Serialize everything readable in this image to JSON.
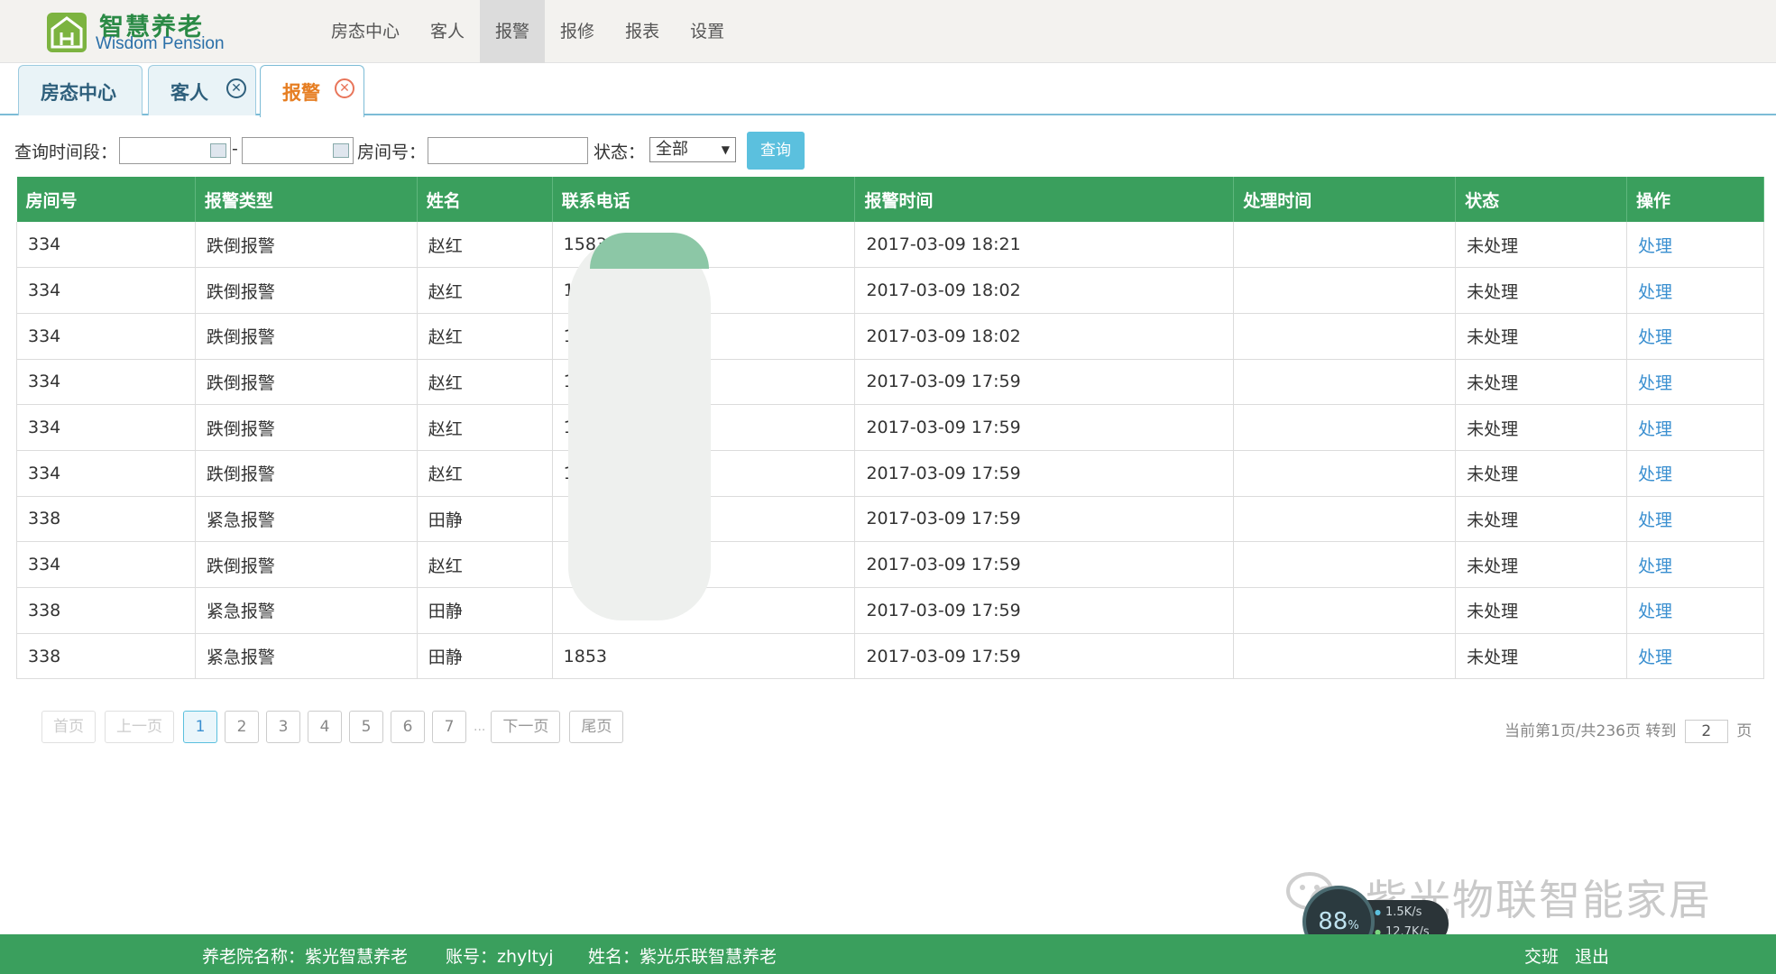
{
  "brand": {
    "name_cn": "智慧养老",
    "name_en": "Wisdom Pension",
    "color": "#3a9f5d"
  },
  "topnav": [
    {
      "label": "房态中心",
      "active": false
    },
    {
      "label": "客人",
      "active": false
    },
    {
      "label": "报警",
      "active": true
    },
    {
      "label": "报修",
      "active": false
    },
    {
      "label": "报表",
      "active": false
    },
    {
      "label": "设置",
      "active": false
    }
  ],
  "tabs": [
    {
      "label": "房态中心",
      "closable": false
    },
    {
      "label": "客人",
      "closable": true
    },
    {
      "label": "报警",
      "closable": true,
      "active": true
    }
  ],
  "filter": {
    "time_label": "查询时间段：",
    "range_sep": "-",
    "room_label": "房间号：",
    "status_label": "状态：",
    "status_value": "全部",
    "query_button": "查询"
  },
  "table": {
    "columns": [
      "房间号",
      "报警类型",
      "姓名",
      "联系电话",
      "报警时间",
      "处理时间",
      "状态",
      "操作"
    ],
    "rows": [
      [
        "334",
        "跌倒报警",
        "赵红",
        "1583",
        "2017-03-09 18:21",
        "",
        "未处理",
        "处理"
      ],
      [
        "334",
        "跌倒报警",
        "赵红",
        "15",
        "2017-03-09 18:02",
        "",
        "未处理",
        "处理"
      ],
      [
        "334",
        "跌倒报警",
        "赵红",
        "15",
        "2017-03-09 18:02",
        "",
        "未处理",
        "处理"
      ],
      [
        "334",
        "跌倒报警",
        "赵红",
        "15",
        "2017-03-09 17:59",
        "",
        "未处理",
        "处理"
      ],
      [
        "334",
        "跌倒报警",
        "赵红",
        "1",
        "2017-03-09 17:59",
        "",
        "未处理",
        "处理"
      ],
      [
        "334",
        "跌倒报警",
        "赵红",
        "1",
        "2017-03-09 17:59",
        "",
        "未处理",
        "处理"
      ],
      [
        "338",
        "紧急报警",
        "田静",
        "",
        "2017-03-09 17:59",
        "",
        "未处理",
        "处理"
      ],
      [
        "334",
        "跌倒报警",
        "赵红",
        "",
        "2017-03-09 17:59",
        "",
        "未处理",
        "处理"
      ],
      [
        "338",
        "紧急报警",
        "田静",
        "",
        "2017-03-09 17:59",
        "",
        "未处理",
        "处理"
      ],
      [
        "338",
        "紧急报警",
        "田静",
        "1853",
        "2017-03-09 17:59",
        "",
        "未处理",
        "处理"
      ]
    ]
  },
  "pager": {
    "first": "首页",
    "prev": "上一页",
    "pages": [
      "1",
      "2",
      "3",
      "4",
      "5",
      "6",
      "7"
    ],
    "current": "1",
    "ellipsis": "...",
    "next": "下一页",
    "last": "尾页",
    "info": "当前第1页/共236页 转到",
    "goto_value": "2",
    "page_suffix": "页"
  },
  "watermark": {
    "text": "紫光物联智能家居"
  },
  "speed_widget": {
    "percent": "88",
    "unit": "%",
    "up": "1.5K/s",
    "down": "12.7K/s"
  },
  "footer": {
    "org": "养老院名称：紫光智慧养老",
    "account": "账号：zhyltyj",
    "name": "姓名：紫光乐联智慧养老",
    "handover": "交班",
    "logout": "退出"
  }
}
